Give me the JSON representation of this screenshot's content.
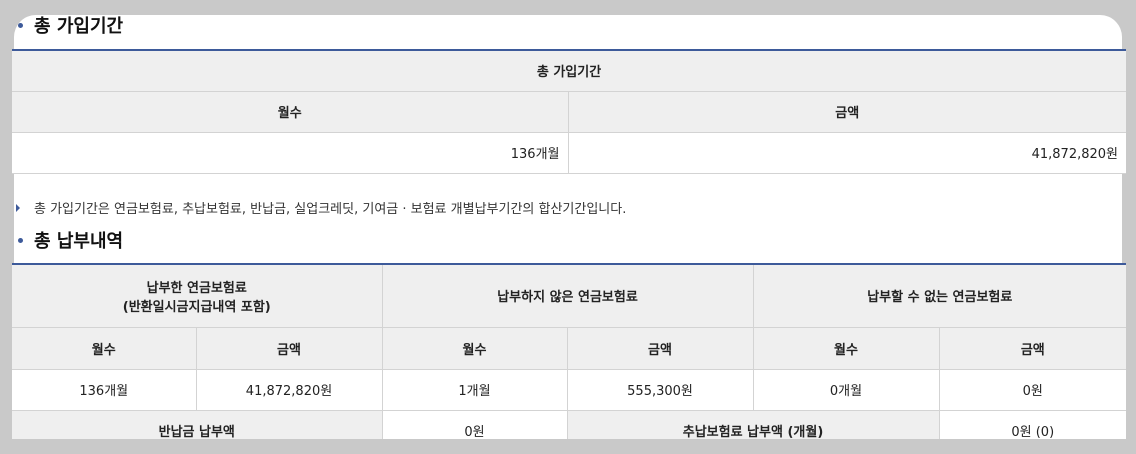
{
  "section1": {
    "title": "총 가입기간",
    "table_caption": "총 가입기간",
    "col_months": "월수",
    "col_amount": "금액",
    "months_value": "136개월",
    "amount_value": "41,872,820원"
  },
  "note": "총 가입기간은 연금보험료, 추납보험료, 반납금, 실업크레딧, 기여금 · 보험료 개별납부기간의 합산기간입니다.",
  "section2": {
    "title": "총 납부내역",
    "group_paid_line1": "납부한 연금보험료",
    "group_paid_line2": "(반환일시금지급내역 포함)",
    "group_unpaid": "납부하지 않은 연금보험료",
    "group_cannot": "납부할 수 없는 연금보험료",
    "col_months": "월수",
    "col_amount": "금액",
    "paid_months": "136개월",
    "paid_amount": "41,872,820원",
    "unpaid_months": "1개월",
    "unpaid_amount": "555,300원",
    "cannot_months": "0개월",
    "cannot_amount": "0원",
    "return_label": "반납금 납부액",
    "return_value": "0원",
    "retro_label": "추납보험료 납부액 (개월)",
    "retro_value": "0원 (0)"
  }
}
